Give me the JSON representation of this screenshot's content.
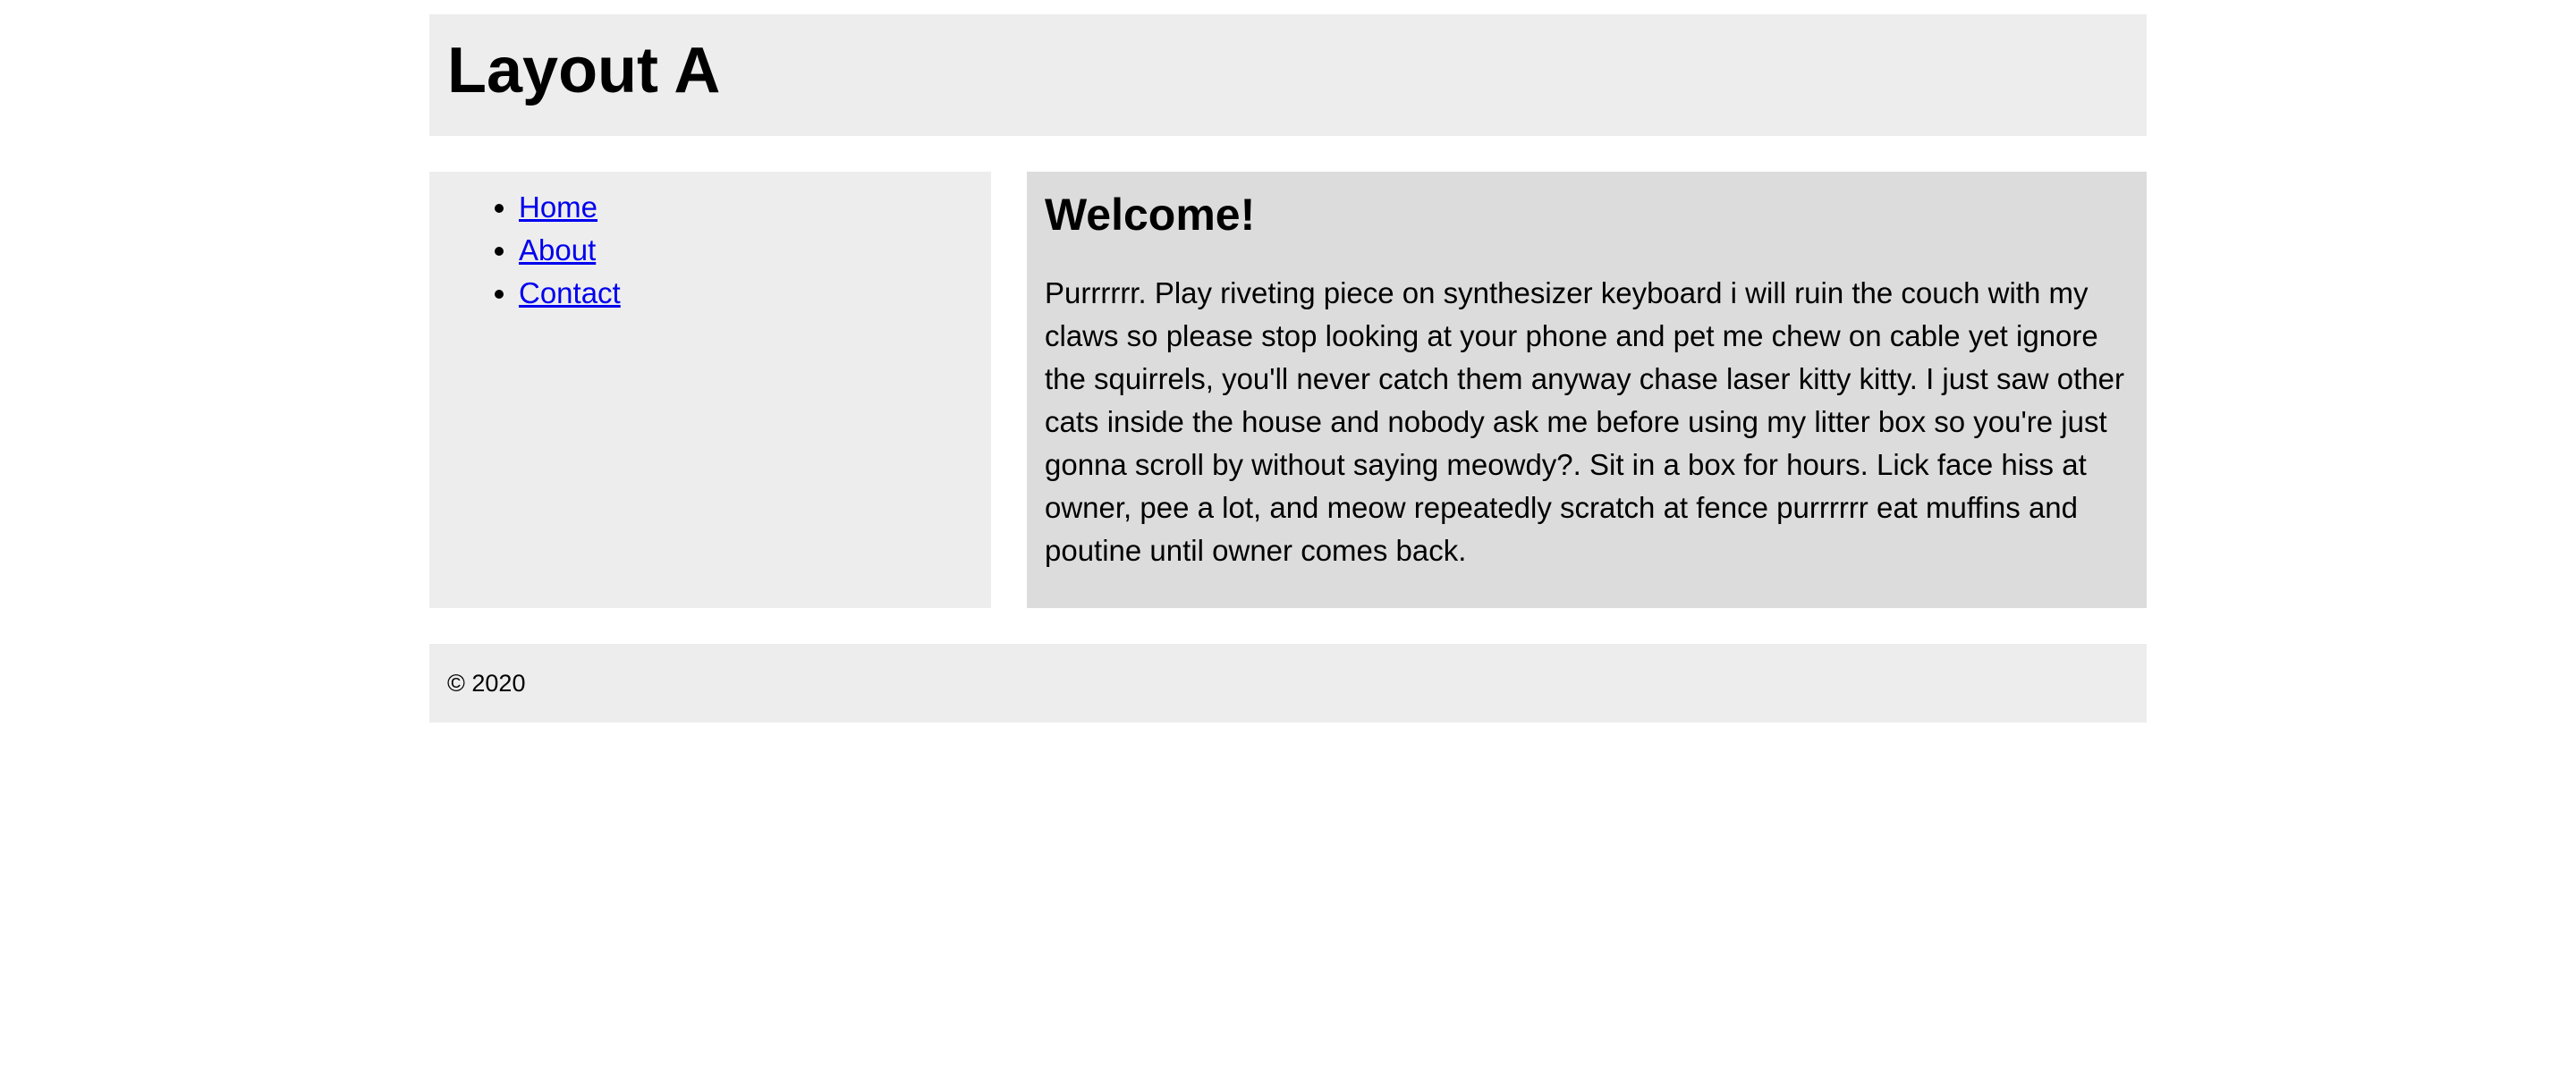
{
  "header": {
    "title": "Layout A"
  },
  "nav": {
    "items": [
      {
        "label": "Home"
      },
      {
        "label": "About"
      },
      {
        "label": "Contact"
      }
    ]
  },
  "main": {
    "heading": "Welcome!",
    "body": "Purrrrrr. Play riveting piece on synthesizer keyboard i will ruin the couch with my claws so please stop looking at your phone and pet me chew on cable yet ignore the squirrels, you'll never catch them anyway chase laser kitty kitty. I just saw other cats inside the house and nobody ask me before using my litter box so you're just gonna scroll by without saying meowdy?. Sit in a box for hours. Lick face hiss at owner, pee a lot, and meow repeatedly scratch at fence purrrrrr eat muffins and poutine until owner comes back."
  },
  "footer": {
    "text": "© 2020"
  },
  "colors": {
    "panel_light": "#ededed",
    "panel_dark": "#dcdcdc",
    "link": "#0000ee"
  }
}
